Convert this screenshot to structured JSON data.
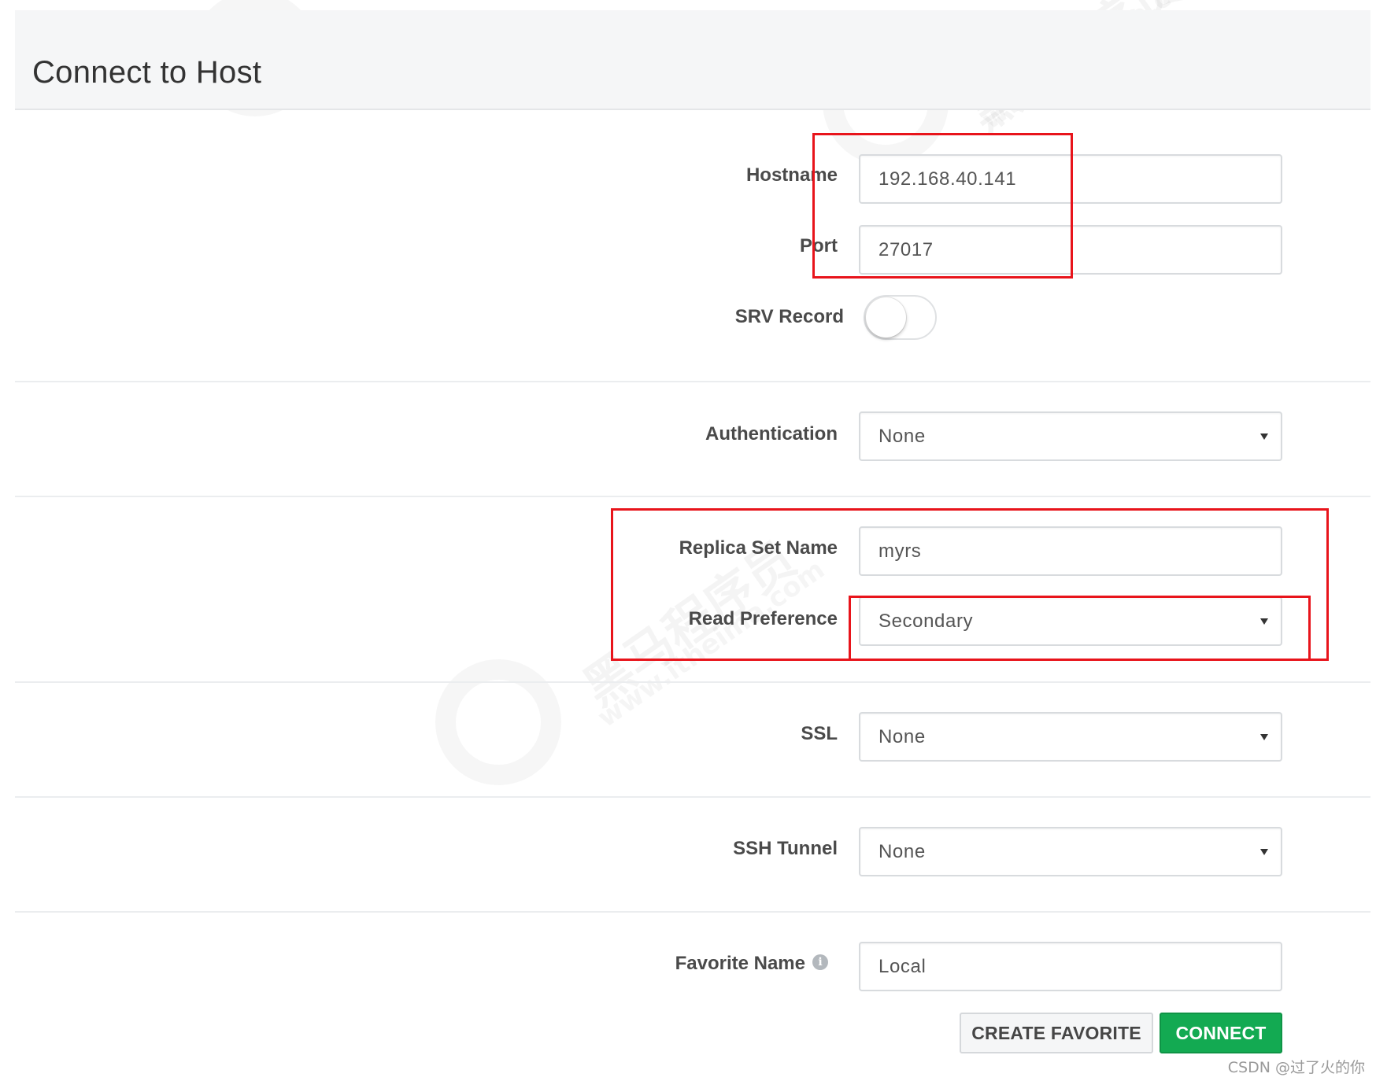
{
  "header": {
    "title": "Connect to Host"
  },
  "form": {
    "hostname": {
      "label": "Hostname",
      "value": "192.168.40.141"
    },
    "port": {
      "label": "Port",
      "value": "27017"
    },
    "srv_record": {
      "label": "SRV Record",
      "enabled": false
    },
    "authentication": {
      "label": "Authentication",
      "value": "None"
    },
    "replica_set_name": {
      "label": "Replica Set Name",
      "value": "myrs"
    },
    "read_preference": {
      "label": "Read Preference",
      "value": "Secondary"
    },
    "ssl": {
      "label": "SSL",
      "value": "None"
    },
    "ssh_tunnel": {
      "label": "SSH Tunnel",
      "value": "None"
    },
    "favorite_name": {
      "label": "Favorite Name",
      "value": "Local",
      "info_icon": "info-icon"
    }
  },
  "buttons": {
    "create_favorite": "CREATE FAVORITE",
    "connect": "CONNECT"
  },
  "colors": {
    "connect_button": "#13aa52",
    "annotation": "#e8141b",
    "header_bg": "#f5f6f7"
  },
  "watermark": {
    "text": "黑马程序员",
    "url": "www.itheima.com"
  },
  "credit": "CSDN @过了火的你"
}
